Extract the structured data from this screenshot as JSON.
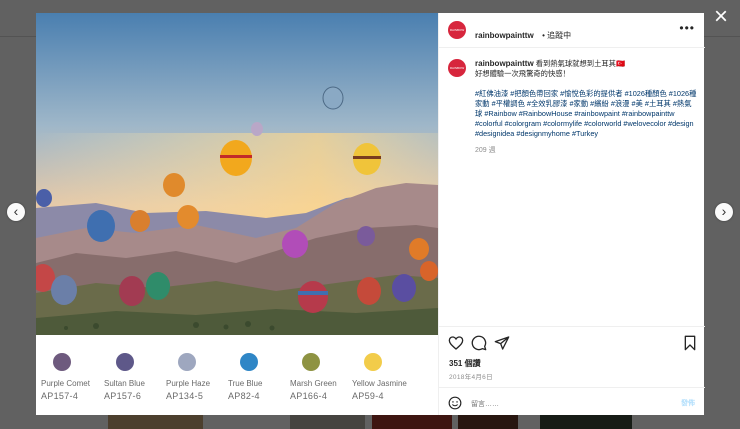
{
  "post": {
    "username": "rainbowpainttw",
    "avatar_text": "RAINBOW PAINT",
    "header_status": "看到熱氣球就想到土耳其🇹🇷",
    "follow_label": "• 追蹤中",
    "caption_line1": "看到熱氣球就想到土耳其🇹🇷",
    "caption_line2": "好想體驗一次飛驚奇的快感！",
    "hashtags": "#紅佛油漆 #把顏色帶回家 #愉悅色彩的提供者 #1026種顏色 #1026種家動 #平權調色 #全效乳膠漆 #家動 #繽紛 #浪漫 #美 #土耳其 #熱氣球 #Rainbow #RainbowHouse #rainbowpaint #rainbowpainttw #colorful #colorgram #colormylife #colorworld #welovecolor #design #designidea #designmyhome #Turkey",
    "time_ago": "209 週",
    "likes": "351 個讚",
    "date": "2018年4月6日",
    "comment_placeholder": "留言……",
    "post_label": "發佈"
  },
  "swatches": [
    {
      "name": "Purple Comet",
      "code": "AP157-4",
      "color": "#6e5a7e"
    },
    {
      "name": "Sultan Blue",
      "code": "AP157-6",
      "color": "#5e5889"
    },
    {
      "name": "Purple Haze",
      "code": "AP134-5",
      "color": "#9ea7bf"
    },
    {
      "name": "True Blue",
      "code": "AP82-4",
      "color": "#2f86c6"
    },
    {
      "name": "Marsh Green",
      "code": "AP166-4",
      "color": "#8e9342"
    },
    {
      "name": "Yellow Jasmine",
      "code": "AP59-4",
      "color": "#f2cc4a"
    }
  ],
  "icons": {
    "close": "×",
    "prev": "‹",
    "next": "›",
    "more": "•••"
  }
}
